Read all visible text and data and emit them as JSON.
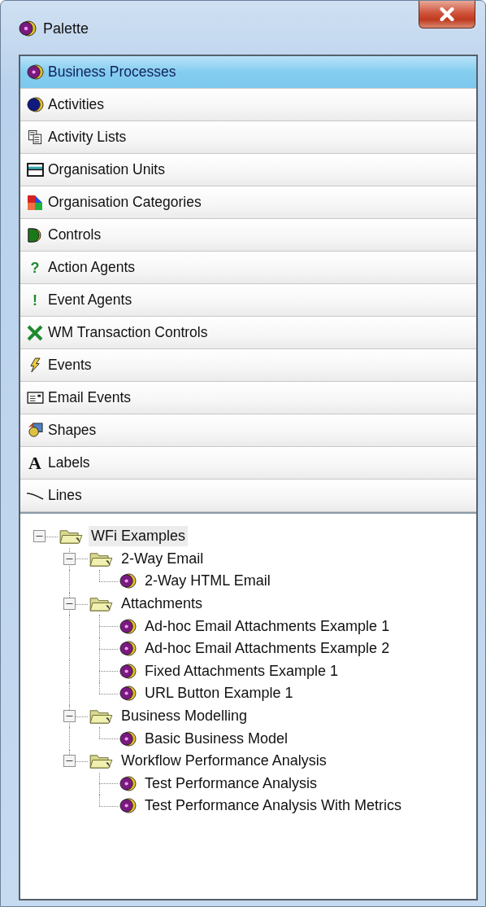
{
  "window": {
    "title": "Palette"
  },
  "categories": [
    {
      "label": "Business Processes",
      "kind": "process",
      "selected": true
    },
    {
      "label": "Activities",
      "kind": "activity",
      "selected": false
    },
    {
      "label": "Activity Lists",
      "kind": "activity-list",
      "selected": false
    },
    {
      "label": "Organisation Units",
      "kind": "org-unit",
      "selected": false
    },
    {
      "label": "Organisation Categories",
      "kind": "org-category",
      "selected": false
    },
    {
      "label": "Controls",
      "kind": "control",
      "selected": false
    },
    {
      "label": "Action Agents",
      "kind": "glyph",
      "glyph": "?",
      "selected": false
    },
    {
      "label": "Event Agents",
      "kind": "glyph",
      "glyph": "!",
      "selected": false
    },
    {
      "label": "WM Transaction Controls",
      "kind": "cross",
      "selected": false
    },
    {
      "label": "Events",
      "kind": "event",
      "selected": false
    },
    {
      "label": "Email Events",
      "kind": "email",
      "selected": false
    },
    {
      "label": "Shapes",
      "kind": "shapes",
      "selected": false
    },
    {
      "label": "Labels",
      "kind": "serif-glyph",
      "glyph": "A",
      "selected": false
    },
    {
      "label": "Lines",
      "kind": "line",
      "selected": false
    }
  ],
  "tree": [
    {
      "label": "WFi Examples",
      "kind": "folder",
      "expanded": true,
      "selected": true,
      "children": [
        {
          "label": "2-Way Email",
          "kind": "folder",
          "expanded": true,
          "selected": false,
          "children": [
            {
              "label": "2-Way HTML Email",
              "kind": "process",
              "selected": false
            }
          ]
        },
        {
          "label": "Attachments",
          "kind": "folder",
          "expanded": true,
          "selected": false,
          "children": [
            {
              "label": "Ad-hoc Email Attachments Example 1",
              "kind": "process",
              "selected": false
            },
            {
              "label": "Ad-hoc Email Attachments Example 2",
              "kind": "process",
              "selected": false
            },
            {
              "label": "Fixed Attachments Example 1",
              "kind": "process",
              "selected": false
            },
            {
              "label": "URL Button Example 1",
              "kind": "process",
              "selected": false
            }
          ]
        },
        {
          "label": "Business Modelling",
          "kind": "folder",
          "expanded": true,
          "selected": false,
          "children": [
            {
              "label": "Basic Business Model",
              "kind": "process",
              "selected": false
            }
          ]
        },
        {
          "label": "Workflow Performance Analysis",
          "kind": "folder",
          "expanded": true,
          "selected": false,
          "children": [
            {
              "label": "Test Performance Analysis",
              "kind": "process",
              "selected": false
            },
            {
              "label": "Test Performance Analysis With Metrics",
              "kind": "process",
              "selected": false
            }
          ]
        }
      ]
    }
  ]
}
